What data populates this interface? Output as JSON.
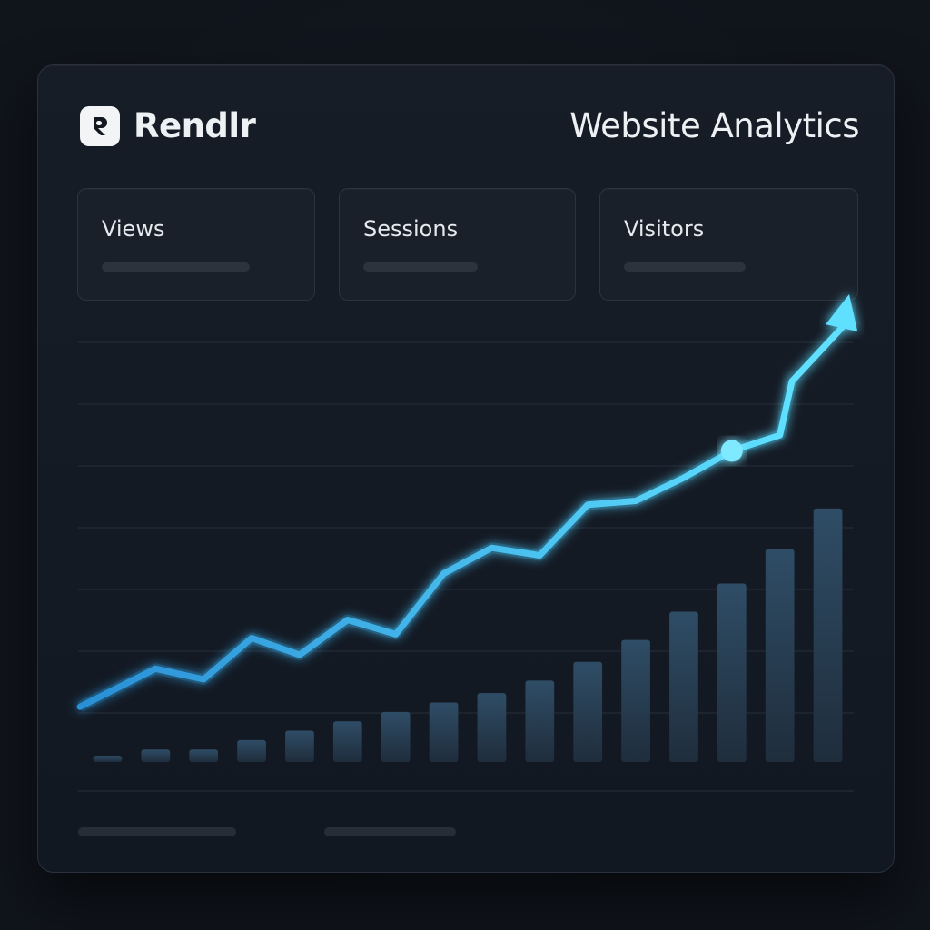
{
  "header": {
    "brand_name": "Rendlr",
    "title": "Website Analytics"
  },
  "icons": {
    "logo": "r-logo-icon",
    "trend": "arrow-up-right-icon"
  },
  "stats": [
    {
      "label": "Views"
    },
    {
      "label": "Sessions"
    },
    {
      "label": "Visitors"
    }
  ],
  "colors": {
    "accent": "#3cc6f5",
    "bar": "#2a4257"
  },
  "chart_data": {
    "type": "bar",
    "bars": {
      "values": [
        1,
        2,
        2,
        3.5,
        5,
        6.5,
        8,
        9.5,
        11,
        13,
        16,
        19.5,
        24,
        28.5,
        34,
        40.5
      ]
    },
    "line": {
      "values": [
        8.8,
        14.9,
        13.2,
        19.8,
        17.1,
        22.7,
        20.4,
        30.1,
        34.2,
        33.0,
        41.1,
        41.7,
        45.4,
        49.7,
        52.2,
        60.8
      ]
    },
    "ylim": [
      0,
      75
    ],
    "grid": true,
    "highlight_index": 13
  }
}
